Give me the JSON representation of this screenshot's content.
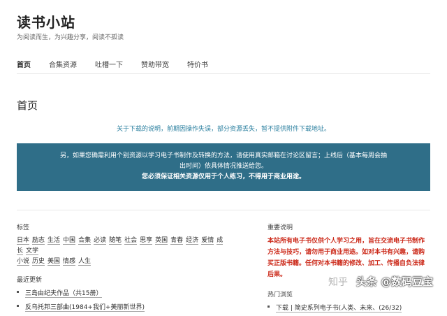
{
  "site": {
    "title": "读书小站",
    "description": "为阅读而生，为兴趣分享，阅读不孤读"
  },
  "nav": {
    "items": [
      {
        "label": "首页",
        "active": true
      },
      {
        "label": "合集资源",
        "active": false
      },
      {
        "label": "吐槽一下",
        "active": false
      },
      {
        "label": "赞助带宽",
        "active": false
      },
      {
        "label": "特价书",
        "active": false
      }
    ]
  },
  "page": {
    "title": "首页",
    "notice": "关于下载的说明，前期因操作失误，部分资源丢失，暂不提供附件下载地址。",
    "banner": {
      "line1": "另，如果您确需利用个别资源以学习电子书制作及转换的方法，请使用真实邮箱在讨论区留言；上线后（基本每周会抽出时间）依具体情况推送给您。",
      "line2": "您必须保证相关资源仅用于个人练习，不得用于商业用途。"
    }
  },
  "tags_widget": {
    "title": "标签",
    "tags": [
      "日本",
      "励志",
      "生活",
      "中国",
      "合集",
      "必读",
      "随笔",
      "社会",
      "思享",
      "英国",
      "青春",
      "经济",
      "爱情",
      "成长",
      "文学",
      "小说",
      "历史",
      "美国",
      "情感",
      "人生"
    ]
  },
  "recent_widget": {
    "title": "最近更新",
    "items": [
      "三岛由纪夫作品（共15册）",
      "反乌托邦三部曲(1984+我们+美丽新世界)"
    ]
  },
  "important_widget": {
    "title": "重要说明",
    "text": "本站所有电子书仅供个人学习之用，旨在交流电子书制作方法与技巧，请勿用于商业用途。如对本书有兴趣，请购买正版书籍。任何对本书籍的修改、加工、传播自负法律后果。"
  },
  "hot_widget": {
    "title": "热门浏览",
    "items": [
      "下载 | 简史系列电子书(人类、未来、(26/32)"
    ]
  },
  "watermark": {
    "zhihu": "知乎",
    "text": "头条 @数码豆宝"
  }
}
